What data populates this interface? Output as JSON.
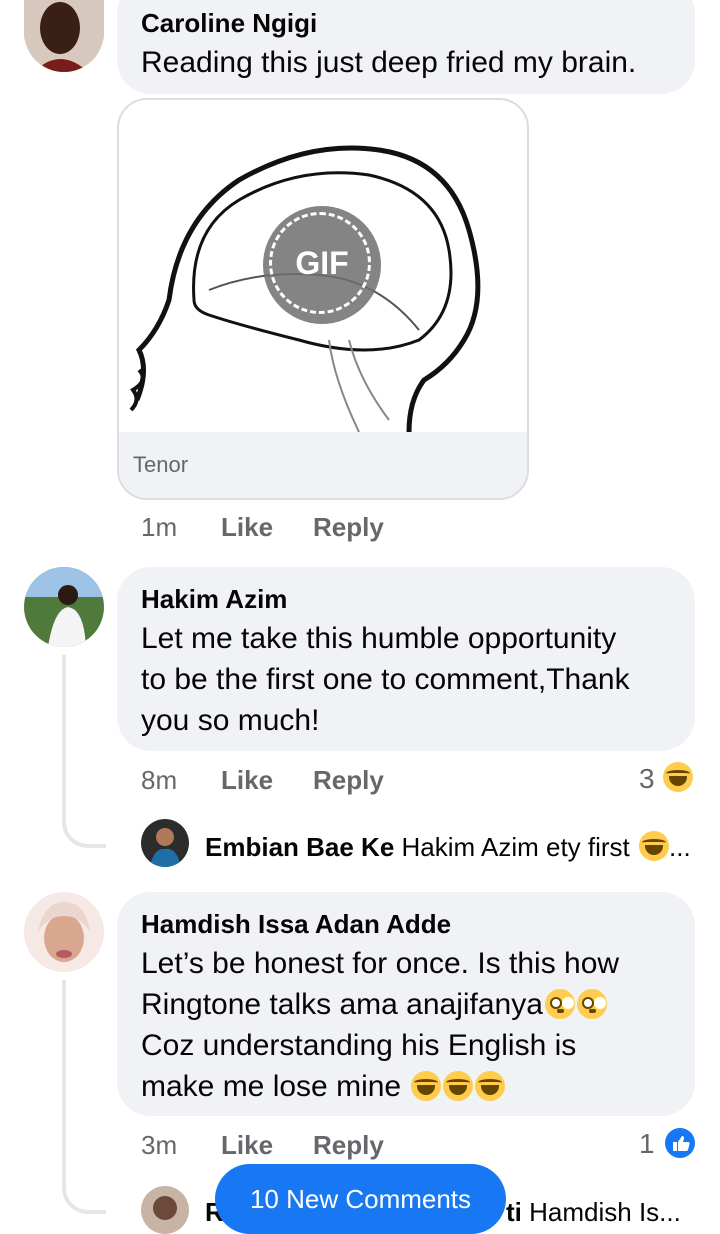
{
  "comments": [
    {
      "author": "Caroline Ngigi",
      "text": "Reading this just deep fried my brain.",
      "gif": {
        "badge": "GIF",
        "source": "Tenor"
      },
      "time": "1m",
      "like": "Like",
      "reply": "Reply"
    },
    {
      "author": "Hakim Azim",
      "text_lines": [
        "Let me take this humble opportunity",
        "to be the first one to comment,Thank",
        "you so much!"
      ],
      "time": "8m",
      "like": "Like",
      "reply": "Reply",
      "reaction_count": "3",
      "reaction_icon": "haha-icon",
      "reply_preview": {
        "author": "Embian Bae Ke",
        "text": "Hakim Azim ety first",
        "ellipsis": "..."
      }
    },
    {
      "author": "Hamdish Issa Adan Adde",
      "text_lines": [
        "Let’s be honest for once. Is this how",
        "Ringtone talks ama anajifanya",
        "Coz understanding his English is",
        "make me lose mine "
      ],
      "time": "3m",
      "like": "Like",
      "reply": "Reply",
      "reaction_count": "1",
      "reaction_icon": "like-icon",
      "reply_preview": {
        "author_visible": "R",
        "author_tail": "ti",
        "text": "Hamdish Is..."
      }
    }
  ],
  "new_comments_button": "10 New Comments",
  "colors": {
    "bubble": "#f0f2f5",
    "meta": "#65676b",
    "accent": "#1877f2",
    "emoji": "#ffcc4d"
  }
}
